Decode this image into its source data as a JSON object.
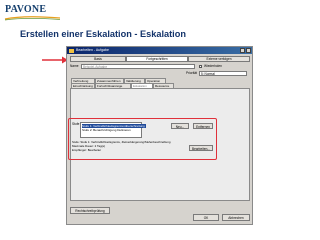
{
  "logo": {
    "text": "PAVONE"
  },
  "page_title": "Erstellen einer Eskalation - Eskalation",
  "dialog": {
    "title": "Bearbeiten - Aufgabe",
    "tabs_top": [
      "Basis",
      "Fortgeschritten",
      "Externe verfolgen"
    ],
    "name_label": "Name",
    "name_value": "Beispiel-Aufgabe",
    "checkbox_label": "Wiederholen",
    "priority_label": "Priorität",
    "priority_value": "5: Normal",
    "tabs_row1": [
      "Verbreitung",
      "Zusammenführen",
      "Validierung",
      "Operation"
    ],
    "tabs_row2": [
      "Einschränkung",
      "Fortschrittsanzeige",
      "Eskalation",
      "Ressource"
    ],
    "active_tab": "Eskalation",
    "stufe_label": "Stufe",
    "stufe_items": [
      "Stufe 1: Verbindlichkeitsgrenzenüberschreitung",
      "Stufe 2: Benachrichtigung Delinieren"
    ],
    "neu_button": "Neu...",
    "entfernen_button": "Entfernen",
    "info_lines": [
      "Stufe: Stufe 1: Verbindlichkeitsgrenze, Zielverkängerung/Stufenbeschreibung",
      "Maximale Dauer: 2 Tag(e)",
      "Empfänger: Bearbeiter"
    ],
    "bearbeiten_button": "Bearbeiten...",
    "rechtschreib_button": "Rechtschreibprüfung",
    "ok_button": "OK",
    "abbrechen_button": "Abbrechen"
  },
  "colors": {
    "title_blue": "#14346b",
    "highlight_red": "#e0303a",
    "titlebar_blue": "#0a246a"
  }
}
